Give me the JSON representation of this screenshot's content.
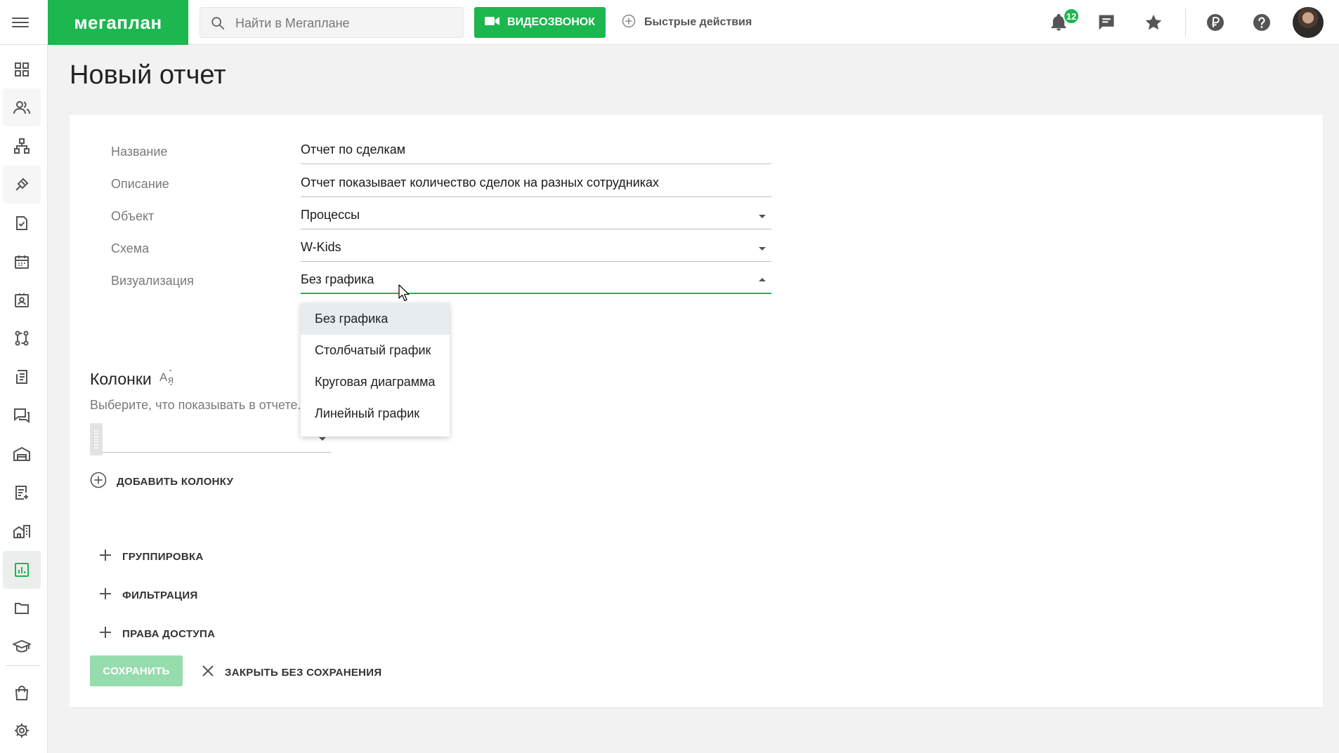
{
  "header": {
    "logo": "мегаплан",
    "search_placeholder": "Найти в Мегаплане",
    "video_call_label": "ВИДЕОЗВОНОК",
    "quick_actions_label": "Быстрые действия",
    "notifications_count": "12",
    "icons": [
      "menu-icon",
      "search-icon",
      "video-camera-icon",
      "plus-circle-icon",
      "bell-icon",
      "chat-icon",
      "star-icon",
      "ruble-icon",
      "help-icon",
      "avatar"
    ]
  },
  "sidebar": {
    "items": [
      "dashboard",
      "contacts",
      "structure",
      "deals",
      "tasks",
      "calendar",
      "employees",
      "processes",
      "documents",
      "discussions",
      "warehouse",
      "invoices",
      "real-estate",
      "reports",
      "files",
      "education",
      "marketplace",
      "settings"
    ],
    "active": "reports"
  },
  "page": {
    "title": "Новый отчет"
  },
  "form": {
    "name_label": "Название",
    "name_value": "Отчет по сделкам",
    "description_label": "Описание",
    "description_value": "Отчет показывает количество сделок на разных сотрудниках",
    "object_label": "Объект",
    "object_value": "Процессы",
    "scheme_label": "Схема",
    "scheme_value": "W-Kids",
    "visualization_label": "Визуализация",
    "visualization_value": "Без графика"
  },
  "visualization_dropdown": {
    "options": [
      "Без графика",
      "Столбчатый график",
      "Круговая диаграмма",
      "Линейный график"
    ],
    "selected": "Без графика"
  },
  "columns": {
    "title": "Колонки",
    "hint": "Выберите, что показывать в отчете.",
    "add_label": "ДОБАВИТЬ КОЛОНКУ"
  },
  "sections": {
    "grouping": "ГРУППИРОВКА",
    "filtering": "ФИЛЬТРАЦИЯ",
    "access": "ПРАВА ДОСТУПА"
  },
  "actions": {
    "save": "СОХРАНИТЬ",
    "close": "ЗАКРЫТЬ БЕЗ СОХРАНЕНИЯ"
  },
  "colors": {
    "brand": "#1db64f",
    "save_disabled": "#97dcad",
    "dropdown_selected": "#e7ecf0"
  }
}
